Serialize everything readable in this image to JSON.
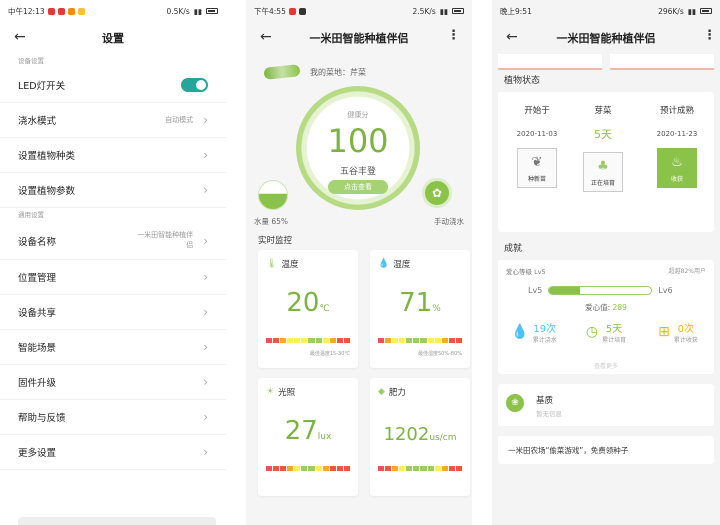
{
  "panel1": {
    "status": {
      "time": "中午12:13",
      "speed": "0.5K/s"
    },
    "title": "设置",
    "section_device": "设备设置",
    "led": {
      "label": "LED灯开关"
    },
    "water_mode": {
      "label": "浇水模式",
      "value": "自动模式"
    },
    "rows_a": [
      "设置植物种类",
      "设置植物参数"
    ],
    "section_general": "通用设置",
    "device_name": {
      "label": "设备名称",
      "value": "一米田智能种植伴侣"
    },
    "rows_b": [
      "位置管理",
      "设备共享",
      "智能场景",
      "固件升级",
      "帮助与反馈",
      "更多设置"
    ]
  },
  "panel2": {
    "status": {
      "time": "下午4:55",
      "speed": "2.5K/s"
    },
    "title": "一米田智能种植伴侣",
    "my_vegetable": "我的菜地：芹菜",
    "gauge": {
      "label": "健康分",
      "score": "100",
      "sub": "五谷丰登",
      "pill": "点击查看"
    },
    "water": {
      "label": "水量 65%"
    },
    "manual": {
      "label": "手动浇水"
    },
    "monitor_title": "实时监控",
    "cards": [
      {
        "title": "温度",
        "icon": "thermometer-icon",
        "value": "20",
        "unit": "℃",
        "foot": "最佳温度15-30℃"
      },
      {
        "title": "湿度",
        "icon": "droplet-icon",
        "value": "71",
        "unit": "%",
        "foot": "最佳湿度50%-80%"
      },
      {
        "title": "光照",
        "icon": "sun-icon",
        "value": "27",
        "unit": "lux",
        "foot": ""
      },
      {
        "title": "肥力",
        "icon": "fertility-icon",
        "value": "1202",
        "unit": "us/cm",
        "foot": ""
      }
    ]
  },
  "panel3": {
    "status": {
      "time": "晚上9:51",
      "speed": "296K/s"
    },
    "title": "一米田智能种植伴侣",
    "state_title": "植物状态",
    "cols": [
      {
        "head": "开始于",
        "value": "2020-11-03",
        "box": "种新苗"
      },
      {
        "head": "芽菜",
        "value": "5天",
        "box": "正在培育"
      },
      {
        "head": "预计成熟",
        "value": "2020-11-23",
        "box": "收获"
      }
    ],
    "achieve_title": "成就",
    "achieve": {
      "badge": "爱心等级 Lv5",
      "right": "超越82%用户",
      "lv_from": "Lv5",
      "lv_to": "Lv6",
      "love_label": "爱心值:",
      "love_value": "289",
      "level_progress": 0.3,
      "stats": [
        {
          "value": "19次",
          "label": "累计浇水",
          "icon": "water-drops-icon",
          "color": "#4fc3f7"
        },
        {
          "value": "5天",
          "label": "累计培育",
          "icon": "clock-icon",
          "color": "#8bc34a"
        },
        {
          "value": "0次",
          "label": "累计收获",
          "icon": "basket-icon",
          "color": "#ffb300"
        }
      ],
      "foot": "查看更多"
    },
    "basis": {
      "title": "基质",
      "sub": "暂无信息"
    },
    "promo": "一米田农场“偷菜游戏”，免费领种子"
  }
}
